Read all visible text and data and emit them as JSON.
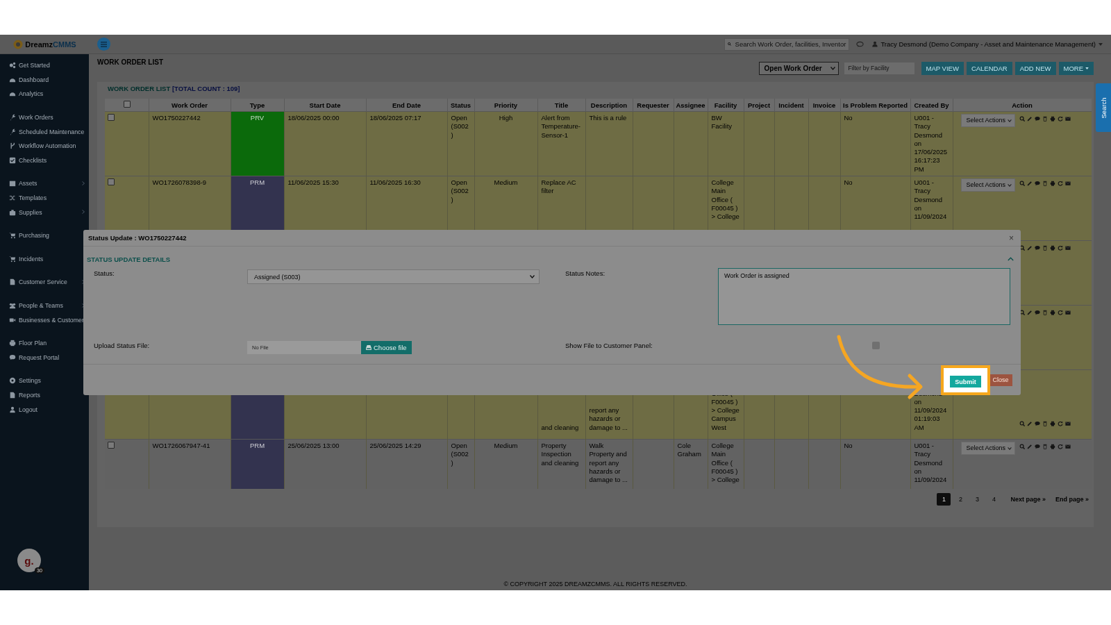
{
  "logo": {
    "primary": "Dreamz",
    "accent": "CMMS"
  },
  "header": {
    "search_placeholder": "Search Work Order, facilities, Inventor",
    "user": "Tracy Desmond (Demo Company - Asset and Maintenance Management)"
  },
  "sidebar": {
    "groups": [
      [
        {
          "label": "Get Started",
          "has_submenu": false
        },
        {
          "label": "Dashboard",
          "has_submenu": false
        },
        {
          "label": "Analytics",
          "has_submenu": false
        }
      ],
      [
        {
          "label": "Work Orders",
          "has_submenu": false
        },
        {
          "label": "Scheduled Maintenance",
          "has_submenu": false
        },
        {
          "label": "Workflow Automation",
          "has_submenu": false
        },
        {
          "label": "Checklists",
          "has_submenu": false
        }
      ],
      [
        {
          "label": "Assets",
          "has_submenu": true
        },
        {
          "label": "Templates",
          "has_submenu": false
        },
        {
          "label": "Supplies",
          "has_submenu": true
        }
      ],
      [
        {
          "label": "Purchasing",
          "has_submenu": false
        }
      ],
      [
        {
          "label": "Incidents",
          "has_submenu": false
        }
      ],
      [
        {
          "label": "Customer Service",
          "has_submenu": true
        }
      ],
      [
        {
          "label": "People & Teams",
          "has_submenu": true
        },
        {
          "label": "Businesses & Customer",
          "has_submenu": false
        }
      ],
      [
        {
          "label": "Floor Plan",
          "has_submenu": false
        },
        {
          "label": "Request Portal",
          "has_submenu": false
        }
      ],
      [
        {
          "label": "Settings",
          "has_submenu": false
        },
        {
          "label": "Reports",
          "has_submenu": false
        },
        {
          "label": "Logout",
          "has_submenu": false
        }
      ]
    ],
    "avatar": {
      "letter": "g.",
      "badge": "30"
    }
  },
  "page_title": "WORK ORDER LIST",
  "toolbar": {
    "status_filter": "Open Work Order",
    "facility_placeholder": "Filter by Facility",
    "buttons": [
      {
        "label": "MAP VIEW",
        "dropdown": false
      },
      {
        "label": "CALENDAR",
        "dropdown": false
      },
      {
        "label": "ADD NEW",
        "dropdown": false
      },
      {
        "label": "MORE",
        "dropdown": true
      }
    ]
  },
  "list": {
    "heading": "WORK ORDER LIST",
    "count": "[TOTAL COUNT : 109]"
  },
  "table": {
    "select_all_checked": false,
    "columns": [
      "Work Order",
      "Type",
      "Start Date",
      "End Date",
      "Status",
      "Priority",
      "Title",
      "Description",
      "Requester",
      "Assignee",
      "Facility",
      "Project",
      "Incident",
      "Invoice",
      "Is Problem Reported",
      "Created By",
      "Action"
    ],
    "rows": [
      {
        "kind": "full",
        "highlighted": true,
        "checked": false,
        "work_order": "WO1750227442",
        "type": {
          "label": "PRV",
          "color": "#0b6a0b"
        },
        "start_date": "18/06/2025 00:00",
        "end_date": "18/06/2025 07:17",
        "status": "Open (S002)",
        "priority": "High",
        "title": "Alert from Temperature-Sensor-1",
        "description": "This is a rule",
        "facility": "BW Facility",
        "problem_reported": "No",
        "created_by": "U001 - Tracy Desmond on 17/06/2025 16:17:23 PM",
        "action": "Select Actions"
      },
      {
        "kind": "full",
        "highlighted": true,
        "checked": false,
        "work_order": "WO1726078398-9",
        "type": {
          "label": "PRM",
          "color": "#33334f"
        },
        "start_date": "11/06/2025 15:30",
        "end_date": "11/06/2025 16:30",
        "status": "Open (S002)",
        "priority": "Medium",
        "title": "Replace AC filter",
        "facility": "College Main Office ( F00045 ) > College",
        "problem_reported": "No",
        "created_by": "U001 - Tracy Desmond on 11/09/2024",
        "action": "Select Actions"
      },
      {
        "kind": "hidden",
        "highlighted": true
      },
      {
        "kind": "hidden",
        "highlighted": true
      },
      {
        "kind": "partial",
        "highlighted": true,
        "type": {
          "color": "#33334f"
        },
        "title": "and cleaning",
        "description": "report any hazards or damage to ...",
        "facility": "Office ( F00045 ) > College Campus West",
        "created_by": "Desmond on 11/09/2024 01:19:03 AM"
      },
      {
        "kind": "full",
        "highlighted": false,
        "checked": false,
        "work_order": "WO1726067947-41",
        "type": {
          "label": "PRM",
          "color": "#33334f"
        },
        "start_date": "25/06/2025 13:00",
        "end_date": "25/06/2025 14:29",
        "status": "Open (S002)",
        "priority": "Medium",
        "title": "Property Inspection and cleaning",
        "description": "Walk Property and report any hazards or damage to ...",
        "assignee": "Cole Graham",
        "facility": "College Main Office ( F00045 ) > College",
        "problem_reported": "No",
        "created_by": "U001 - Tracy Desmond on 11/09/2024",
        "action": "Select Actions"
      }
    ]
  },
  "pagination": {
    "pages": [
      {
        "label": "1",
        "selected": true
      },
      {
        "label": "2",
        "selected": false
      },
      {
        "label": "3",
        "selected": false
      },
      {
        "label": "4",
        "selected": false
      }
    ],
    "next": "Next page »",
    "end": "End page »"
  },
  "footer": "© COPYRIGHT 2025 DREAMZCMMS. ALL RIGHTS RESERVED.",
  "side_tab": "Search",
  "modal": {
    "title": "Status Update : WO1750227442",
    "close": "×",
    "section": "STATUS UPDATE DETAILS",
    "expanded": true,
    "status": {
      "label": "Status:",
      "value": "Assigned (S003)"
    },
    "notes": {
      "label": "Status Notes:",
      "value": "Work Order is assigned"
    },
    "upload": {
      "label": "Upload Status File:",
      "file": "No File",
      "button": "Choose file"
    },
    "show_file": {
      "label": "Show File to Customer Panel:",
      "checked": false
    },
    "buttons": {
      "submit": "Submit",
      "close": "Close"
    }
  }
}
